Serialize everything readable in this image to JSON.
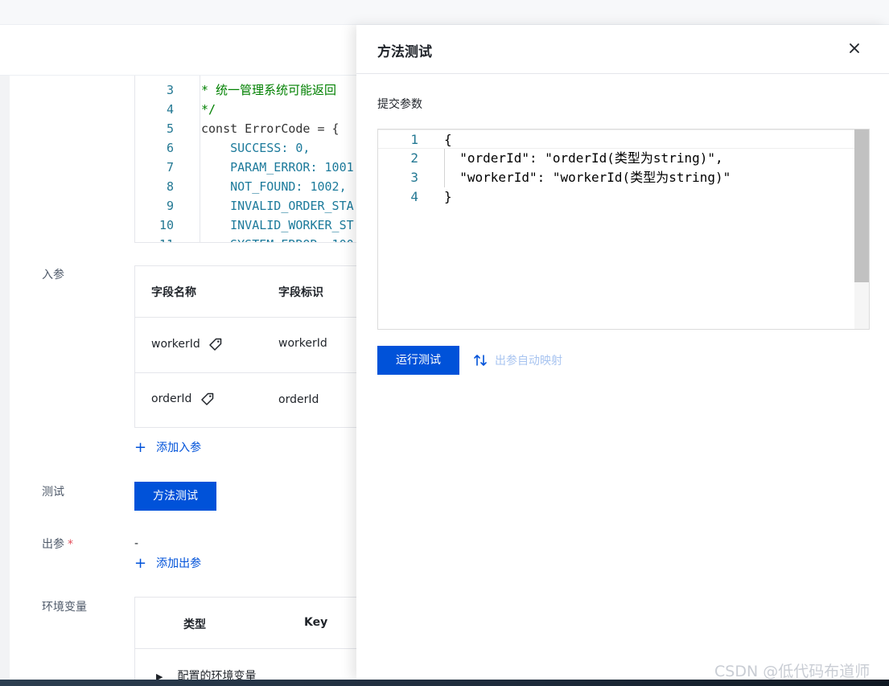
{
  "code": {
    "lines": [
      {
        "n": "",
        "t": "",
        "cls": "c-green"
      },
      {
        "n": "3",
        "t": "* 统一管理系统可能返回",
        "cls": "c-green"
      },
      {
        "n": "4",
        "t": "*/",
        "cls": "c-green"
      },
      {
        "n": "5",
        "t": "const ErrorCode = {",
        "cls": "c-def"
      },
      {
        "n": "6",
        "t": "    SUCCESS: 0,",
        "cls": "c-prop"
      },
      {
        "n": "7",
        "t": "    PARAM_ERROR: 1001",
        "cls": "c-prop"
      },
      {
        "n": "8",
        "t": "    NOT_FOUND: 1002,",
        "cls": "c-prop"
      },
      {
        "n": "9",
        "t": "    INVALID_ORDER_STA",
        "cls": "c-prop"
      },
      {
        "n": "10",
        "t": "    INVALID_WORKER_ST",
        "cls": "c-prop"
      },
      {
        "n": "11",
        "t": "    SYSTEM_ERROR: 100",
        "cls": "c-prop"
      }
    ]
  },
  "form": {
    "input_params_label": "入参",
    "table_in": {
      "headers": [
        "字段名称",
        "字段标识"
      ],
      "rows": [
        {
          "name": "workerId",
          "key": "workerId"
        },
        {
          "name": "orderId",
          "key": "orderId"
        }
      ]
    },
    "add_input_label": "添加入参",
    "test_label": "测试",
    "method_test_button": "方法测试",
    "output_params_label": "出参",
    "output_value": "-",
    "add_output_label": "添加出参",
    "env_label": "环境变量",
    "table_env": {
      "headers": [
        "类型",
        "Key"
      ],
      "row_label": "配置的环境变量"
    }
  },
  "drawer": {
    "title": "方法测试",
    "submit_params_label": "提交参数",
    "editor_lines": [
      {
        "n": "1",
        "t": "{"
      },
      {
        "n": "2",
        "t": "  \"orderId\": \"orderId(类型为string)\","
      },
      {
        "n": "3",
        "t": "  \"workerId\": \"workerId(类型为string)\""
      },
      {
        "n": "4",
        "t": "}"
      }
    ],
    "run_button": "运行测试",
    "auto_map_label": "出参自动映射"
  },
  "watermark": "CSDN @低代码布道师",
  "colors": {
    "primary": "#0052d9",
    "disabled_link": "#a8c4f0",
    "required": "#e34d59"
  },
  "icons": [
    "tag-icon",
    "close-icon",
    "plus-icon",
    "swap-icon",
    "caret-right-icon"
  ]
}
